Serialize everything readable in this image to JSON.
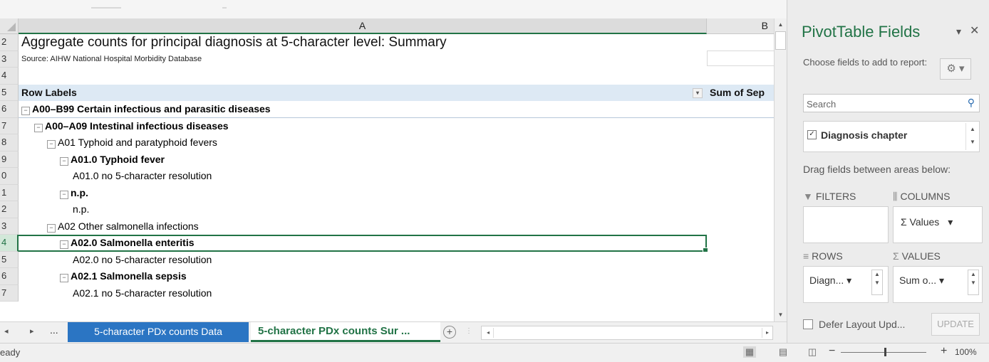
{
  "columns": {
    "a": "A",
    "b": "B"
  },
  "row_numbers": [
    "2",
    "3",
    "4",
    "5",
    "6",
    "7",
    "8",
    "9",
    "0",
    "1",
    "2",
    "3",
    "4",
    "5",
    "6",
    "7"
  ],
  "sheet": {
    "title": "Aggregate counts for principal diagnosis at 5-character level: Summary",
    "source": "Source: AIHW National Hospital Morbidity Database",
    "header_a": "Row Labels",
    "header_b": "Sum of Sep",
    "rows": [
      {
        "text": "A00–B99 Certain infectious and parasitic diseases",
        "toggle": "⊟",
        "indent": 0,
        "bold": true
      },
      {
        "text": "A00–A09 Intestinal infectious diseases",
        "toggle": "⊟",
        "indent": 1,
        "bold": true
      },
      {
        "text": "A01 Typhoid and paratyphoid fevers",
        "toggle": "⊟",
        "indent": 2,
        "bold": false
      },
      {
        "text": "A01.0 Typhoid fever",
        "toggle": "⊟",
        "indent": 3,
        "bold": true
      },
      {
        "text": "A01.0 no 5-character resolution",
        "toggle": "",
        "indent": 4,
        "bold": false
      },
      {
        "text": "n.p.",
        "toggle": "⊟",
        "indent": 3,
        "bold": true
      },
      {
        "text": "n.p.",
        "toggle": "",
        "indent": 4,
        "bold": false
      },
      {
        "text": "A02 Other salmonella infections",
        "toggle": "⊟",
        "indent": 2,
        "bold": false
      },
      {
        "text": "A02.0 Salmonella enteritis",
        "toggle": "⊟",
        "indent": 3,
        "bold": true
      },
      {
        "text": "A02.0 no 5-character resolution",
        "toggle": "",
        "indent": 4,
        "bold": false
      },
      {
        "text": "A02.1 Salmonella sepsis",
        "toggle": "⊟",
        "indent": 3,
        "bold": true
      },
      {
        "text": "A02.1 no 5-character resolution",
        "toggle": "",
        "indent": 4,
        "bold": false
      }
    ]
  },
  "tabs": {
    "nav_prev": "◂",
    "nav_next": "▸",
    "nav_more": "...",
    "data": "5-character PDx counts Data",
    "summary": "5-character PDx counts Sur ...",
    "add": "+"
  },
  "status": {
    "ready": "eady",
    "zoom_minus": "−",
    "zoom_plus": "+",
    "zoom": "100%"
  },
  "pivot": {
    "title": "PivotTable Fields",
    "choose": "Choose fields to add to report:",
    "search_placeholder": "Search",
    "field": "Diagnosis chapter",
    "field_checked": "✓",
    "drag": "Drag fields between areas below:",
    "filters_label": "FILTERS",
    "columns_label": "COLUMNS",
    "rows_label": "ROWS",
    "values_label": "VALUES",
    "columns_item": "Σ Values",
    "rows_item": "Diagn...",
    "values_item": "Sum o...",
    "defer": "Defer Layout Upd...",
    "update": "UPDATE"
  },
  "colors": {
    "accent": "#217346",
    "tab_blue": "#2b75c3",
    "header_blue": "#dde9f4"
  }
}
